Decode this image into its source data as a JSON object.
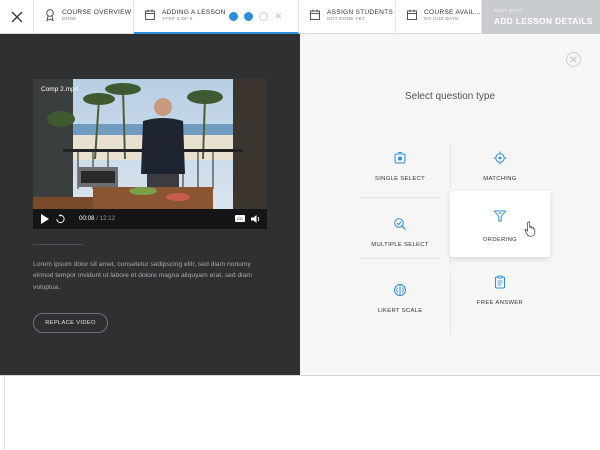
{
  "header": {
    "steps": [
      {
        "title": "COURSE OVERVIEW",
        "subtitle": "DONE",
        "icon": "ribbon-icon"
      },
      {
        "title": "ADDING A LESSON",
        "subtitle": "STEP 2 OF 6",
        "icon": "calendar-icon"
      },
      {
        "title": "ASSIGN STUDENTS",
        "subtitle": "NOT DONE YET",
        "icon": "calendar-icon"
      },
      {
        "title": "COURSE AVAIL...",
        "subtitle": "NO DUE DATE",
        "icon": "calendar-icon"
      }
    ],
    "progress_dots": {
      "filled": 2,
      "empty": 1
    },
    "next_step": {
      "small": "NEXT STEP",
      "label": "ADD LESSON DETAILS"
    }
  },
  "video": {
    "title": "Comp 2.mp4",
    "current_time": "00:08",
    "separator": " / ",
    "duration": "12:12",
    "cc_label": "CC"
  },
  "left": {
    "description": "Lorem ipsum dolor sit amet, consetetur sadipscing elitr, sed diam nonumy eirmod tempor invidunt ut labore et dolore magna aliquyam erat, sed diam voluptua.",
    "replace_button": "REPLACE VIDEO"
  },
  "question_panel": {
    "title": "Select question type",
    "options": [
      {
        "label": "SINGLE SELECT",
        "icon": "single-select-icon"
      },
      {
        "label": "MATCHING",
        "icon": "crosshair-icon"
      },
      {
        "label": "MULTIPLE SELECT",
        "icon": "multiple-select-icon"
      },
      {
        "label": "ORDERING",
        "icon": "funnel-icon",
        "selected": true
      },
      {
        "label": "LIKERT SCALE",
        "icon": "scale-icon"
      },
      {
        "label": "FREE ANSWER",
        "icon": "clipboard-icon"
      }
    ]
  },
  "colors": {
    "accent": "#2b8fd9",
    "dark_panel": "#2e3032",
    "next_step_bg": "#c9ccce"
  }
}
